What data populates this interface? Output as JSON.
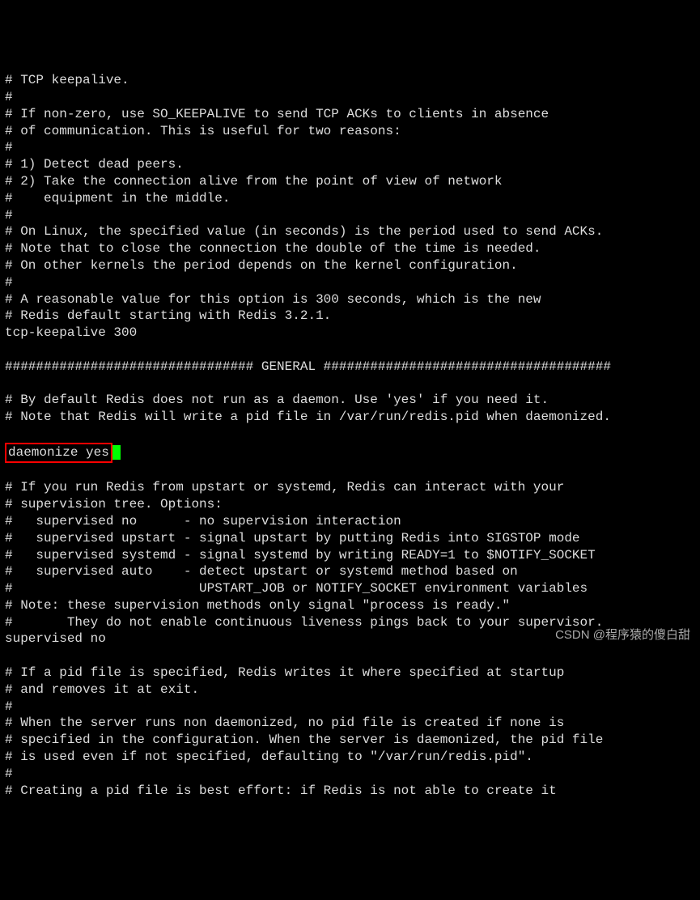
{
  "lines": [
    "# TCP keepalive.",
    "#",
    "# If non-zero, use SO_KEEPALIVE to send TCP ACKs to clients in absence",
    "# of communication. This is useful for two reasons:",
    "#",
    "# 1) Detect dead peers.",
    "# 2) Take the connection alive from the point of view of network",
    "#    equipment in the middle.",
    "#",
    "# On Linux, the specified value (in seconds) is the period used to send ACKs.",
    "# Note that to close the connection the double of the time is needed.",
    "# On other kernels the period depends on the kernel configuration.",
    "#",
    "# A reasonable value for this option is 300 seconds, which is the new",
    "# Redis default starting with Redis 3.2.1.",
    "tcp-keepalive 300",
    "",
    "################################ GENERAL #####################################",
    "",
    "# By default Redis does not run as a daemon. Use 'yes' if you need it.",
    "# Note that Redis will write a pid file in /var/run/redis.pid when daemonized."
  ],
  "highlight": "daemonize yes",
  "lines_after": [
    "",
    "# If you run Redis from upstart or systemd, Redis can interact with your",
    "# supervision tree. Options:",
    "#   supervised no      - no supervision interaction",
    "#   supervised upstart - signal upstart by putting Redis into SIGSTOP mode",
    "#   supervised systemd - signal systemd by writing READY=1 to $NOTIFY_SOCKET",
    "#   supervised auto    - detect upstart or systemd method based on",
    "#                        UPSTART_JOB or NOTIFY_SOCKET environment variables",
    "# Note: these supervision methods only signal \"process is ready.\"",
    "#       They do not enable continuous liveness pings back to your supervisor.",
    "supervised no",
    "",
    "# If a pid file is specified, Redis writes it where specified at startup",
    "# and removes it at exit.",
    "#",
    "# When the server runs non daemonized, no pid file is created if none is",
    "# specified in the configuration. When the server is daemonized, the pid file",
    "# is used even if not specified, defaulting to \"/var/run/redis.pid\".",
    "#",
    "# Creating a pid file is best effort: if Redis is not able to create it"
  ],
  "watermark": "CSDN @程序猿的傻白甜"
}
